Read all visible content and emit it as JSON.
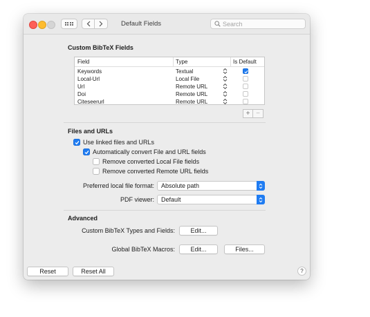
{
  "window": {
    "title": "Default Fields"
  },
  "search": {
    "placeholder": "Search"
  },
  "custom_fields": {
    "heading": "Custom BibTeX Fields",
    "columns": [
      "Field",
      "Type",
      "Is Default"
    ],
    "rows": [
      {
        "field": "Keywords",
        "type": "Textual",
        "is_default": true
      },
      {
        "field": "Local-Url",
        "type": "Local File",
        "is_default": false
      },
      {
        "field": "Url",
        "type": "Remote URL",
        "is_default": false
      },
      {
        "field": "Doi",
        "type": "Remote URL",
        "is_default": false
      },
      {
        "field": "Citeseerurl",
        "type": "Remote URL",
        "is_default": false
      }
    ],
    "add_label": "+",
    "remove_label": "−"
  },
  "files_urls": {
    "heading": "Files and URLs",
    "use_linked": {
      "label": "Use linked files and URLs",
      "checked": true
    },
    "auto_convert": {
      "label": "Automatically convert File and URL fields",
      "checked": true
    },
    "remove_local": {
      "label": "Remove converted Local File fields",
      "checked": false
    },
    "remove_remote": {
      "label": "Remove converted Remote URL fields",
      "checked": false
    },
    "local_format_label": "Preferred local file format:",
    "local_format_value": "Absolute path",
    "pdf_viewer_label": "PDF viewer:",
    "pdf_viewer_value": "Default"
  },
  "advanced": {
    "heading": "Advanced",
    "types_label": "Custom BibTeX Types and Fields:",
    "types_edit": "Edit...",
    "macros_label": "Global BibTeX Macros:",
    "macros_edit": "Edit...",
    "macros_files": "Files..."
  },
  "footer": {
    "reset": "Reset",
    "reset_all": "Reset All",
    "help": "?"
  },
  "colors": {
    "accent": "#1f7cf2",
    "window_bg": "#ececec"
  }
}
